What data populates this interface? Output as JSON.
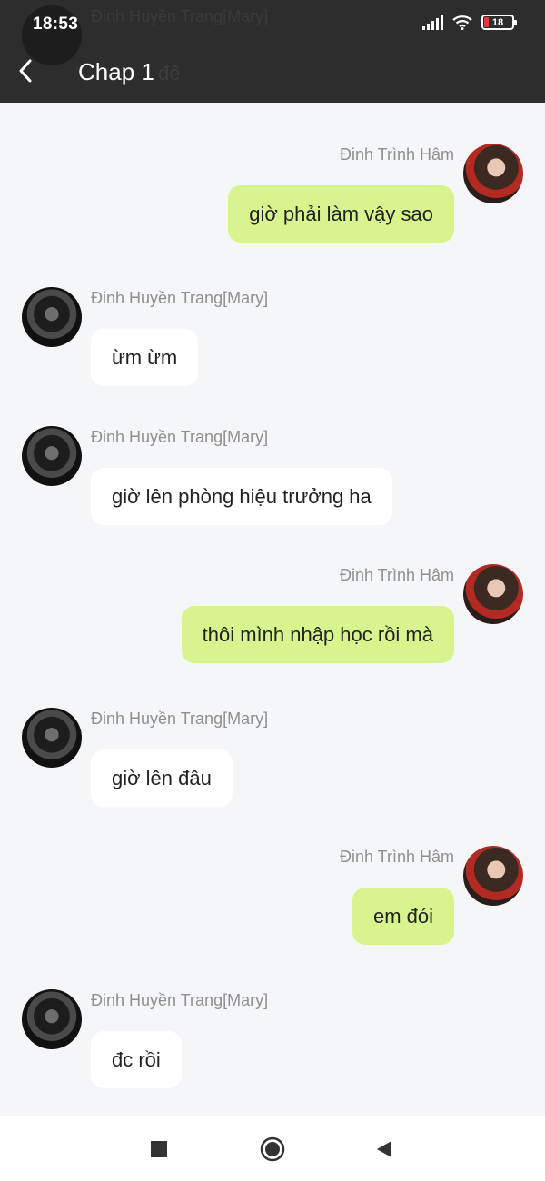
{
  "status": {
    "time": "18:53",
    "battery": "18"
  },
  "header": {
    "title": "Chap 1",
    "ghost_text": "đê",
    "ghost_name": "Đinh Huyền Trang[Mary]"
  },
  "messages": [
    {
      "side": "right",
      "sender": "Đinh Trình Hâm",
      "text": "giờ phải làm vậy sao"
    },
    {
      "side": "left",
      "sender": "Đinh Huyền Trang[Mary]",
      "text": "ừm ừm"
    },
    {
      "side": "left",
      "sender": "Đinh Huyền Trang[Mary]",
      "text": "giờ lên phòng hiệu trưởng ha"
    },
    {
      "side": "right",
      "sender": "Đinh Trình Hâm",
      "text": "thôi mình nhập học rồi mà"
    },
    {
      "side": "left",
      "sender": "Đinh Huyền Trang[Mary]",
      "text": "giờ lên đâu"
    },
    {
      "side": "right",
      "sender": "Đinh Trình Hâm",
      "text": "em đói"
    },
    {
      "side": "left",
      "sender": "Đinh Huyền Trang[Mary]",
      "text": "đc rồi"
    }
  ],
  "icons": {
    "back": "chevron-left-icon",
    "recent": "square-icon",
    "home": "circle-icon",
    "nav_back": "triangle-back-icon"
  }
}
